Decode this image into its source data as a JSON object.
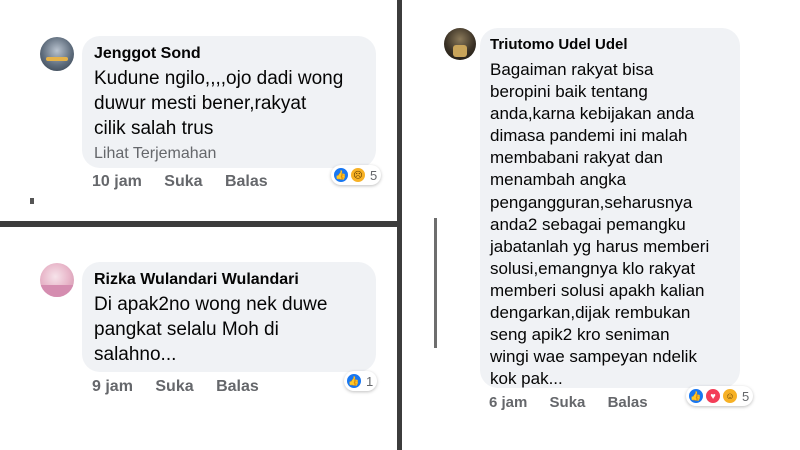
{
  "comments": [
    {
      "author": "Jenggot Sond",
      "lines": [
        "Kudune ngilo,,,,ojo dadi wong",
        "duwur mesti bener,rakyat",
        "cilik salah trus"
      ],
      "translate_label": "Lihat Terjemahan",
      "time": "10 jam",
      "like_label": "Suka",
      "reply_label": "Balas",
      "reactions": [
        "like-icon",
        "sad-icon"
      ],
      "reaction_count": "5"
    },
    {
      "author": "Rizka Wulandari Wulandari",
      "lines": [
        "Di apak2no wong nek duwe",
        "pangkat selalu Moh di",
        "salahno..."
      ],
      "time": "9 jam",
      "like_label": "Suka",
      "reply_label": "Balas",
      "reactions": [
        "like-icon"
      ],
      "reaction_count": "1"
    },
    {
      "author": "Triutomo Udel Udel",
      "lines": [
        "Bagaiman rakyat bisa",
        "beropini baik tentang",
        "anda,karna kebijakan anda",
        "dimasa pandemi ini malah",
        "membabani rakyat dan",
        "menambah angka",
        "pengangguran,seharusnya",
        "anda2 sebagai pemangku",
        "jabatanlah yg harus memberi",
        "solusi,emangnya klo rakyat",
        "memberi solusi apakh kalian",
        "dengarkan,dijak rembukan",
        "seng apik2 kro seniman",
        "wingi wae sampeyan ndelik",
        "kok pak..."
      ],
      "time": "6 jam",
      "like_label": "Suka",
      "reply_label": "Balas",
      "reactions": [
        "like-icon",
        "love-icon",
        "haha-icon"
      ],
      "reaction_count": "5"
    }
  ],
  "colors": {
    "bubble": "#f0f2f5",
    "meta_text": "#65676b",
    "like": "#1877f2",
    "love": "#f33e58",
    "sad": "#f7b125"
  }
}
